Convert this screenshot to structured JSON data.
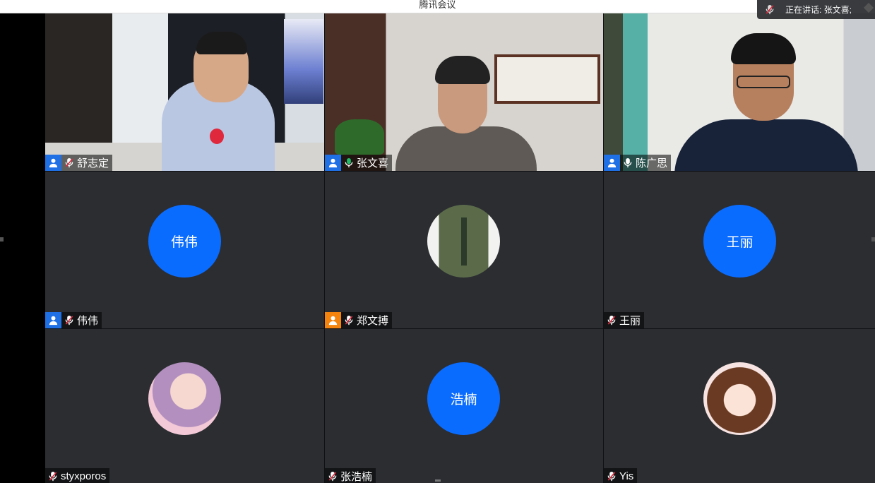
{
  "window": {
    "title": "腾讯会议"
  },
  "speaking": {
    "text": "正在讲话: 张文喜;"
  },
  "colors": {
    "accent": "#0a6cff",
    "active_border": "#1fbf6a",
    "muted_mic": "#e0283c",
    "host_badge": "#f4840e"
  },
  "participants": [
    {
      "name": "舒志定",
      "video": true,
      "badge": "blue",
      "mic": "muted"
    },
    {
      "name": "张文喜",
      "video": true,
      "badge": "blue",
      "mic": "speaking",
      "active": true
    },
    {
      "name": "陈广思",
      "video": true,
      "badge": "blue",
      "mic": "on"
    },
    {
      "name": "伟伟",
      "video": false,
      "avatar_text": "伟伟",
      "badge": "blue",
      "mic": "muted"
    },
    {
      "name": "郑文搏",
      "video": false,
      "avatar": "photo",
      "badge": "orange",
      "mic": "muted"
    },
    {
      "name": "王丽",
      "video": false,
      "avatar_text": "王丽",
      "badge": "none",
      "mic": "muted"
    },
    {
      "name": "styxporos",
      "video": false,
      "avatar": "photo",
      "badge": "none",
      "mic": "muted"
    },
    {
      "name": "张浩楠",
      "video": false,
      "avatar_text": "浩楠",
      "badge": "none",
      "mic": "muted"
    },
    {
      "name": "Yis",
      "video": false,
      "avatar": "photo",
      "badge": "none",
      "mic": "muted"
    }
  ]
}
